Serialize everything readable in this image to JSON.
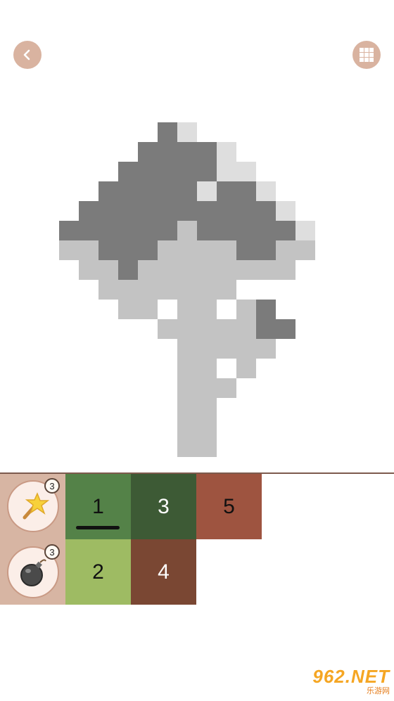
{
  "header": {
    "back_icon": "chevron-left-icon",
    "grid_icon": "grid-icon"
  },
  "tools": [
    {
      "name": "magic-wand",
      "icon": "magic-wand-icon",
      "count": "3"
    },
    {
      "name": "bomb",
      "icon": "bomb-icon",
      "count": "3"
    }
  ],
  "palette": [
    {
      "number": "1",
      "color": "#548248",
      "text_color": "#111111",
      "selected": true
    },
    {
      "number": "3",
      "color": "#3d5a35",
      "text_color": "#ffffff",
      "selected": false
    },
    {
      "number": "5",
      "color": "#9e5440",
      "text_color": "#111111",
      "selected": false
    },
    {
      "number": "2",
      "color": "#9ebb63",
      "text_color": "#111111",
      "selected": false
    },
    {
      "number": "4",
      "color": "#7a4733",
      "text_color": "#ffffff",
      "selected": false
    }
  ],
  "watermark": {
    "main": "962.NET",
    "sub": "乐游网"
  },
  "colors": {
    "accent": "#d9b3a0",
    "dark_gray": "#7b7b7b",
    "light_gray": "#c3c3c3",
    "faint_gray": "#dedede"
  }
}
